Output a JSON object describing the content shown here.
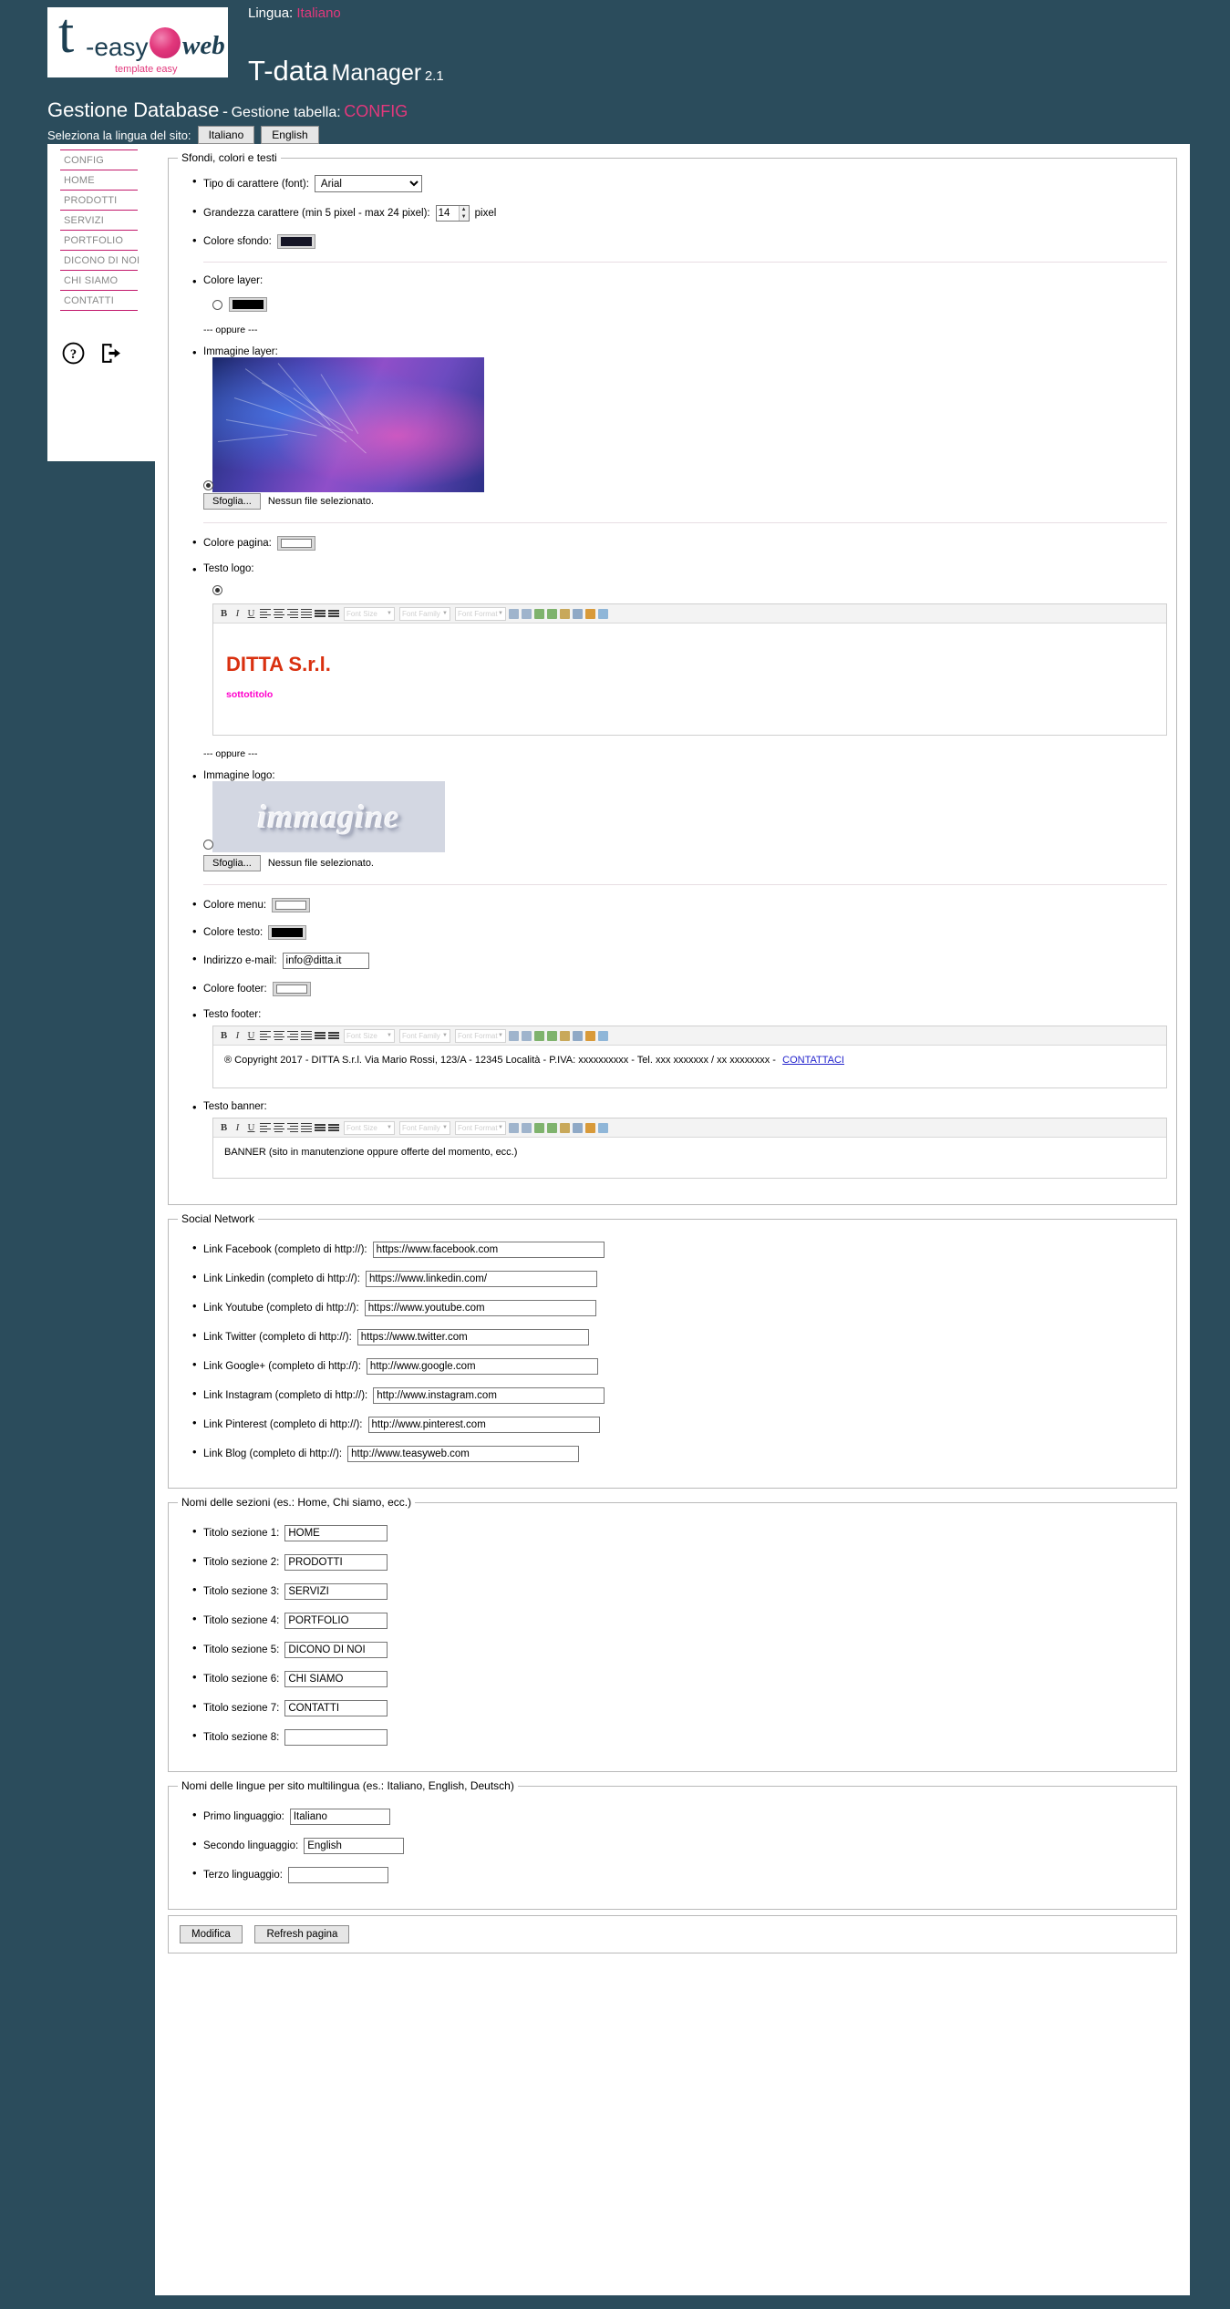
{
  "header": {
    "logo": {
      "t": "t",
      "easy": "-easy",
      "web": "web",
      "tagline": "template easy"
    },
    "lingua_label": "Lingua:",
    "lingua_value": "Italiano",
    "app_title": "T-data",
    "app_subtitle": "Manager",
    "app_version": "2.1",
    "page_title": "Gestione Database",
    "page_dash": "-",
    "table_label": "Gestione tabella:",
    "table_name": "CONFIG",
    "site_lang_label": "Seleziona la lingua del sito:",
    "lang_buttons": [
      "Italiano",
      "English"
    ]
  },
  "sidebar": {
    "items": [
      {
        "label": "CONFIG"
      },
      {
        "label": "HOME"
      },
      {
        "label": "PRODOTTI"
      },
      {
        "label": "SERVIZI"
      },
      {
        "label": "PORTFOLIO"
      },
      {
        "label": "DICONO DI NOI"
      },
      {
        "label": "CHI SIAMO"
      },
      {
        "label": "CONTATTI"
      }
    ],
    "icons": [
      {
        "name": "help-icon"
      },
      {
        "name": "logout-icon"
      }
    ]
  },
  "fieldsets": {
    "backgrounds": {
      "legend": "Sfondi, colori e testi",
      "font_label": "Tipo di carattere (font):",
      "font_value": "Arial",
      "size_label": "Grandezza carattere (min 5 pixel - max 24 pixel):",
      "size_value": "14",
      "size_unit": "pixel",
      "bg_color_label": "Colore sfondo:",
      "bg_color_value": "#151526",
      "layer_color_label": "Colore layer:",
      "layer_color_value": "#000000",
      "oppure": "--- oppure ---",
      "layer_image_label": "Immagine layer:",
      "page_color_label": "Colore pagina:",
      "page_color_value": "#ffffff",
      "logo_text_label": "Testo logo:",
      "logo_title": "DITTA S.r.l.",
      "logo_subtitle": "sottotitolo",
      "logo_image_label": "Immagine logo:",
      "logo_image_text": "immagine",
      "menu_color_label": "Colore menu:",
      "menu_color_value": "#ffffff",
      "text_color_label": "Colore testo:",
      "text_color_value": "#000000",
      "email_label": "Indirizzo e-mail:",
      "email_value": "info@ditta.it",
      "footer_color_label": "Colore footer:",
      "footer_color_value": "#ffffff",
      "footer_text_label": "Testo footer:",
      "footer_text": "® Copyright 2017 - DITTA S.r.l. Via Mario Rossi, 123/A - 12345 Località - P.IVA: xxxxxxxxxx - Tel. xxx xxxxxxx / xx xxxxxxxx -",
      "footer_link": "CONTATTACI",
      "banner_text_label": "Testo banner:",
      "banner_text": "BANNER (sito in manutenzione oppure offerte del momento, ecc.)",
      "file_button": "Sfoglia...",
      "file_status": "Nessun file selezionato."
    },
    "social": {
      "legend": "Social Network",
      "links": [
        {
          "label": "Link Facebook (completo di http://):",
          "value": "https://www.facebook.com"
        },
        {
          "label": "Link Linkedin (completo di http://):",
          "value": "https://www.linkedin.com/"
        },
        {
          "label": "Link Youtube (completo di http://):",
          "value": "https://www.youtube.com"
        },
        {
          "label": "Link Twitter (completo di http://):",
          "value": "https://www.twitter.com"
        },
        {
          "label": "Link Google+ (completo di http://):",
          "value": "http://www.google.com"
        },
        {
          "label": "Link Instagram (completo di http://):",
          "value": "http://www.instagram.com"
        },
        {
          "label": "Link Pinterest (completo di http://):",
          "value": "http://www.pinterest.com"
        },
        {
          "label": "Link Blog (completo di http://):",
          "value": "http://www.teasyweb.com"
        }
      ]
    },
    "sections": {
      "legend": "Nomi delle sezioni (es.: Home, Chi siamo, ecc.)",
      "rows": [
        {
          "label": "Titolo sezione 1:",
          "value": "HOME"
        },
        {
          "label": "Titolo sezione 2:",
          "value": "PRODOTTI"
        },
        {
          "label": "Titolo sezione 3:",
          "value": "SERVIZI"
        },
        {
          "label": "Titolo sezione 4:",
          "value": "PORTFOLIO"
        },
        {
          "label": "Titolo sezione 5:",
          "value": "DICONO DI NOI"
        },
        {
          "label": "Titolo sezione 6:",
          "value": "CHI SIAMO"
        },
        {
          "label": "Titolo sezione 7:",
          "value": "CONTATTI"
        },
        {
          "label": "Titolo sezione 8:",
          "value": ""
        }
      ]
    },
    "languages": {
      "legend": "Nomi delle lingue per sito multilingua (es.: Italiano, English, Deutsch)",
      "rows": [
        {
          "label": "Primo linguaggio:",
          "value": "Italiano"
        },
        {
          "label": "Secondo linguaggio:",
          "value": "English"
        },
        {
          "label": "Terzo linguaggio:",
          "value": ""
        }
      ]
    }
  },
  "buttons": {
    "submit": "Modifica",
    "refresh": "Refresh pagina"
  },
  "colors": {
    "page_bg": "#2b4c5c",
    "accent_pink": "#e2387c",
    "nav_divider": "#c2186b",
    "nav_text": "#888888"
  }
}
